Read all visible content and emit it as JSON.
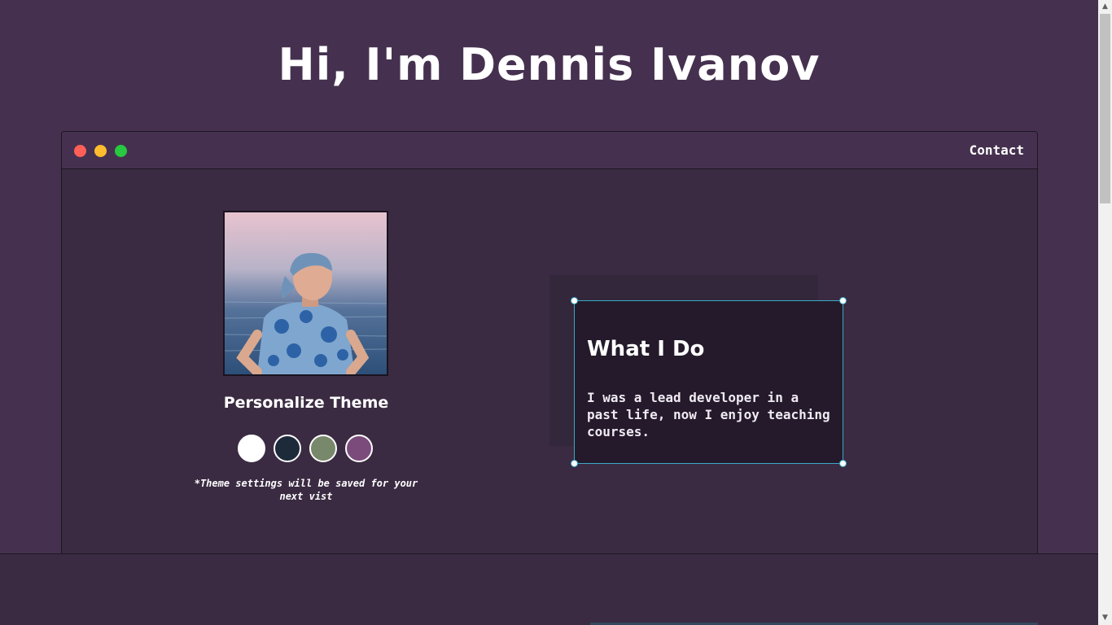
{
  "header": {
    "title": "Hi, I'm Dennis Ivanov"
  },
  "window": {
    "controls": [
      "close",
      "minimize",
      "maximize"
    ],
    "nav": {
      "contact_label": "Contact"
    }
  },
  "profile": {
    "photo_icon": "profile-photo-icon",
    "personalize_title": "Personalize Theme",
    "theme_swatches": [
      {
        "name": "light",
        "color": "#ffffff"
      },
      {
        "name": "blue",
        "color": "#1c2a3a"
      },
      {
        "name": "green",
        "color": "#78886a"
      },
      {
        "name": "purple",
        "color": "#7b4b7c"
      }
    ],
    "theme_note": "*Theme settings will be saved for your next vist"
  },
  "about": {
    "title": "What I Do",
    "text": "I was a lead developer in a past life, now I enjoy teaching courses."
  },
  "colors": {
    "background": "#45314f",
    "window_body": "#3a2b42",
    "card": "#241a2b",
    "selection": "#3aa9c7"
  }
}
